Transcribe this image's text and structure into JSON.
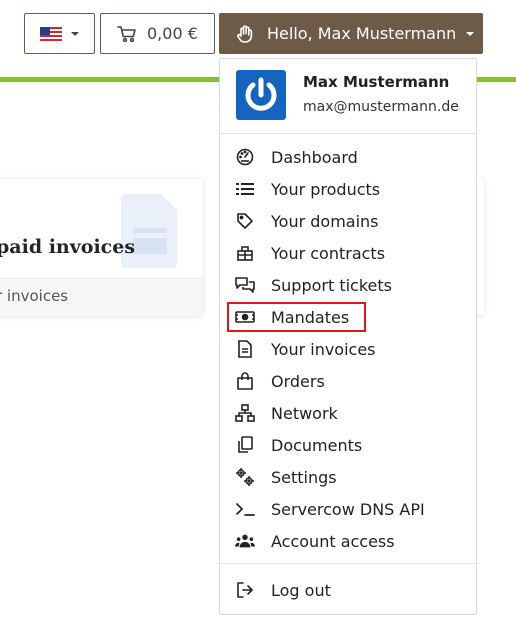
{
  "header": {
    "language": {
      "flag": "us-flag-icon"
    },
    "cart": {
      "amount": "0,00 €"
    },
    "user_button": {
      "label": "Hello, Max Mustermann"
    }
  },
  "card": {
    "title": "paid invoices",
    "footer_link": "r invoices"
  },
  "user_menu": {
    "name": "Max Mustermann",
    "email": "max@mustermann.de",
    "items": [
      {
        "label": "Dashboard",
        "icon": "dashboard-gauge-icon"
      },
      {
        "label": "Your products",
        "icon": "list-icon"
      },
      {
        "label": "Your domains",
        "icon": "tag-icon"
      },
      {
        "label": "Your contracts",
        "icon": "contract-icon"
      },
      {
        "label": "Support tickets",
        "icon": "chat-bubbles-icon"
      },
      {
        "label": "Mandates",
        "icon": "money-bill-icon",
        "highlighted": true
      },
      {
        "label": "Your invoices",
        "icon": "invoice-icon"
      },
      {
        "label": "Orders",
        "icon": "shopping-bag-icon"
      },
      {
        "label": "Network",
        "icon": "network-icon"
      },
      {
        "label": "Documents",
        "icon": "documents-icon"
      },
      {
        "label": "Settings",
        "icon": "gears-icon"
      },
      {
        "label": "Servercow DNS API",
        "icon": "terminal-icon"
      },
      {
        "label": "Account access",
        "icon": "users-icon"
      }
    ],
    "logout": {
      "label": "Log out",
      "icon": "logout-icon"
    }
  },
  "colors": {
    "brand_brown": "#6e5b47",
    "accent_green": "#84c225",
    "highlight_red": "#e8141a",
    "avatar_blue": "#1565c0"
  }
}
